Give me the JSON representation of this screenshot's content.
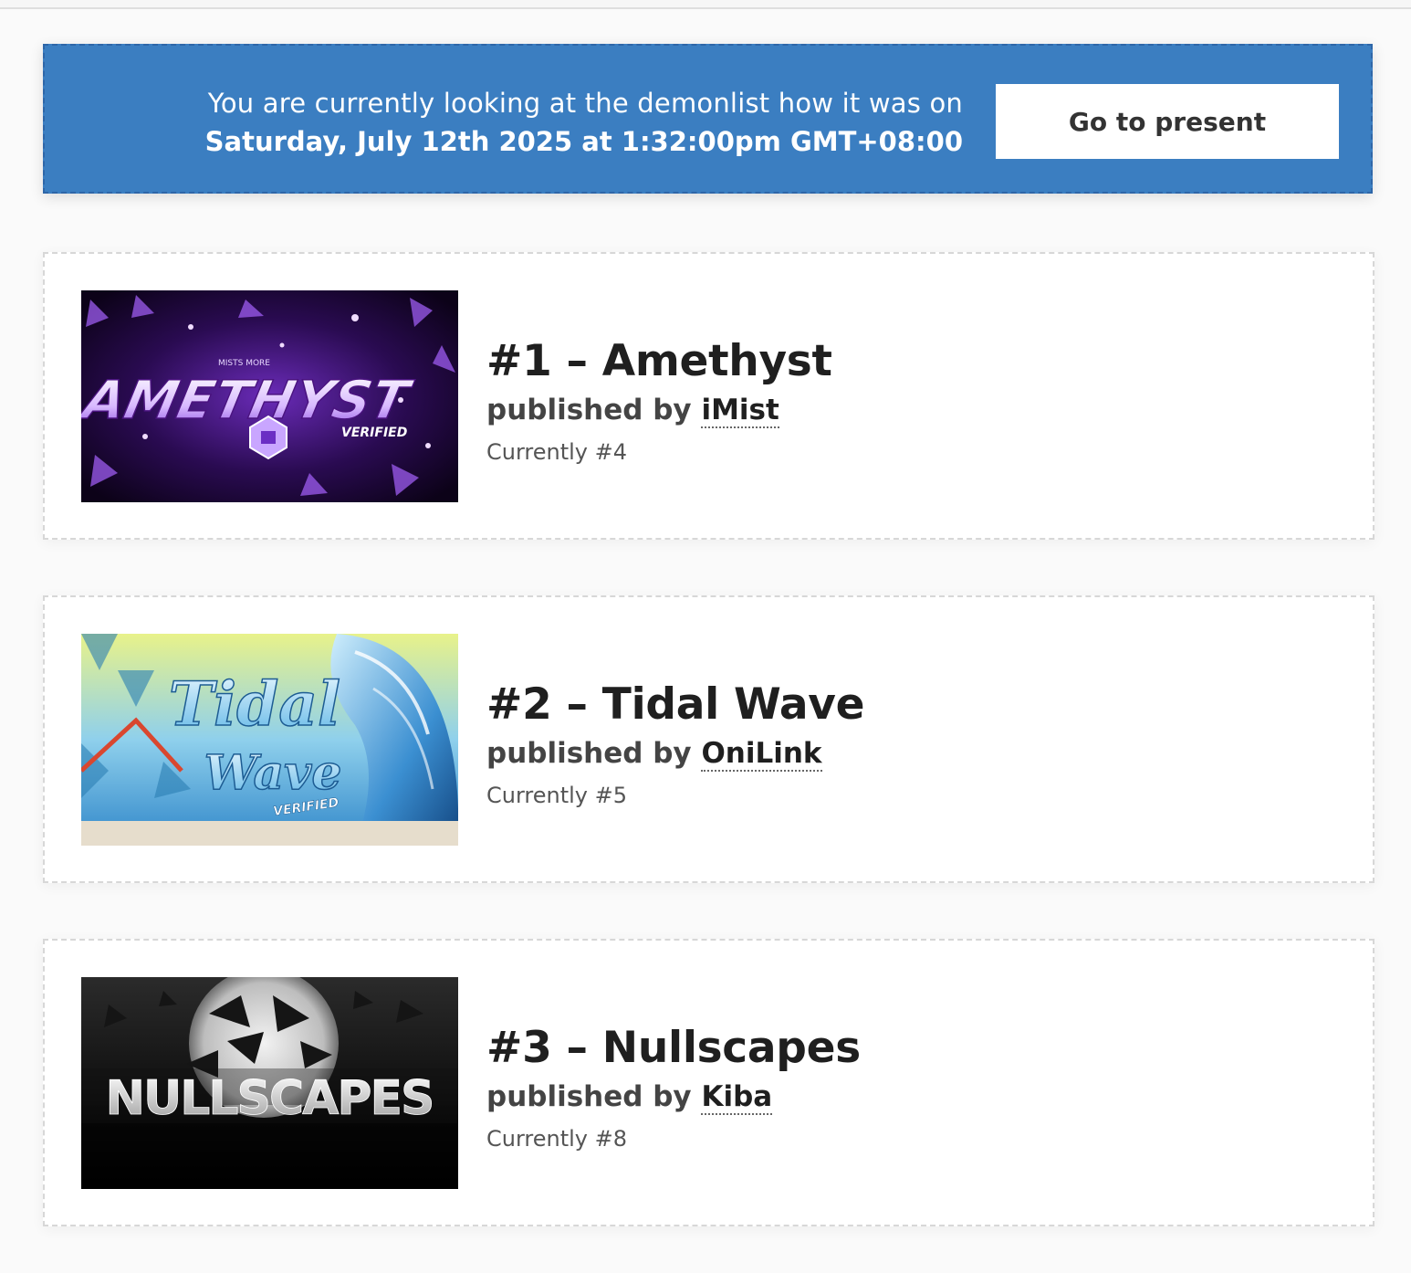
{
  "banner": {
    "line1": "You are currently looking at the demonlist how it was on",
    "line2": "Saturday, July 12th 2025 at 1:32:00pm GMT+08:00",
    "button_label": "Go to present",
    "color": "#3b7ec1"
  },
  "levels": [
    {
      "title": "#1 – Amethyst",
      "published_prefix": "published by",
      "publisher": "iMist",
      "current": "Currently #4",
      "thumbnail": {
        "text": "AMETHYST",
        "subtext": "VERIFIED",
        "small_text": "MISTS MORE",
        "colors": [
          "#1a0630",
          "#7b2fd1",
          "#c99bff"
        ]
      }
    },
    {
      "title": "#2 – Tidal Wave",
      "published_prefix": "published by",
      "publisher": "OniLink",
      "current": "Currently #5",
      "thumbnail": {
        "text": "Tidal",
        "text2": "Wave",
        "subtext": "VERIFIED",
        "colors": [
          "#2f86c9",
          "#9fd6f2",
          "#f1e27a"
        ]
      }
    },
    {
      "title": "#3 – Nullscapes",
      "published_prefix": "published by",
      "publisher": "Kiba",
      "current": "Currently #8",
      "thumbnail": {
        "text": "NULLSCAPES",
        "colors": [
          "#000000",
          "#444444",
          "#e8e8e8"
        ]
      }
    }
  ]
}
